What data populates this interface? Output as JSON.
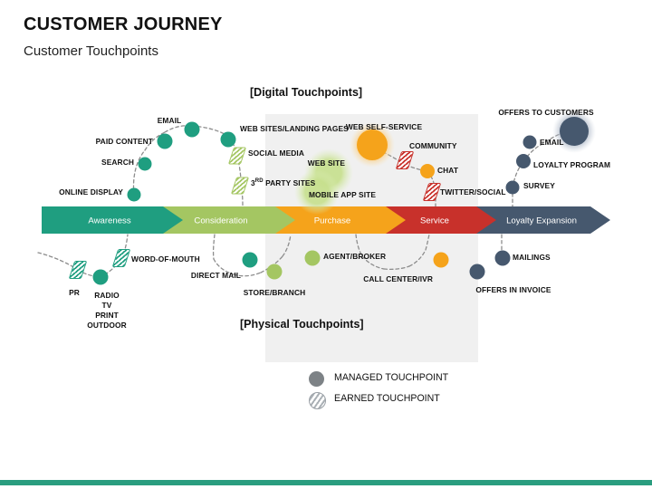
{
  "header": {
    "title": "CUSTOMER JOURNEY",
    "subtitle": "Customer Touchpoints"
  },
  "sections": {
    "digital": "[Digital Touchpoints]",
    "physical": "[Physical Touchpoints]"
  },
  "stages": [
    {
      "label": "Awareness",
      "color": "#1f9e80"
    },
    {
      "label": "Consideration",
      "color": "#a4c662"
    },
    {
      "label": "Purchase",
      "color": "#f5a31b"
    },
    {
      "label": "Service",
      "color": "#c8312b"
    },
    {
      "label": "Loyalty Expansion",
      "color": "#46586e"
    }
  ],
  "legend": [
    {
      "label": "MANAGED TOUCHPOINT",
      "kind": "managed"
    },
    {
      "label": "EARNED TOUCHPOINT",
      "kind": "earned"
    }
  ],
  "digital_touchpoints": [
    {
      "label": "ONLINE DISPLAY",
      "kind": "managed",
      "color": "#1f9e80"
    },
    {
      "label": "SEARCH",
      "kind": "managed",
      "color": "#1f9e80"
    },
    {
      "label": "PAID CONTENT",
      "kind": "managed",
      "color": "#1f9e80"
    },
    {
      "label": "EMAIL",
      "kind": "managed",
      "color": "#1f9e80"
    },
    {
      "label": "WEB SITES/LANDING PAGES",
      "kind": "managed",
      "color": "#1f9e80"
    },
    {
      "label": "SOCIAL MEDIA",
      "kind": "earned",
      "color": "#a4c662"
    },
    {
      "label": "3RD PARTY SITES",
      "kind": "earned",
      "color": "#a4c662"
    },
    {
      "label": "WEB SITE",
      "kind": "managed",
      "color": "#b9d77e"
    },
    {
      "label": "MOBILE APP SITE",
      "kind": "managed",
      "color": "#b9d77e"
    },
    {
      "label": "WEB SELF-SERVICE",
      "kind": "managed",
      "color": "#f5a31b"
    },
    {
      "label": "COMMUNITY",
      "kind": "earned",
      "color": "#c8312b"
    },
    {
      "label": "CHAT",
      "kind": "managed",
      "color": "#f5a31b"
    },
    {
      "label": "TWITTER/SOCIAL",
      "kind": "earned",
      "color": "#c8312b"
    },
    {
      "label": "SURVEY",
      "kind": "managed",
      "color": "#46586e"
    },
    {
      "label": "LOYALTY PROGRAM",
      "kind": "managed",
      "color": "#46586e"
    },
    {
      "label": "EMAIL",
      "kind": "managed",
      "color": "#46586e"
    },
    {
      "label": "OFFERS TO CUSTOMERS",
      "kind": "managed",
      "color": "#46586e"
    }
  ],
  "physical_touchpoints": [
    {
      "label": "PR",
      "kind": "earned",
      "color": "#1f9e80"
    },
    {
      "label": "RADIO\nTV\nPRINT\nOUTDOOR",
      "kind": "managed",
      "color": "#1f9e80"
    },
    {
      "label": "WORD-OF-MOUTH",
      "kind": "earned",
      "color": "#1f9e80"
    },
    {
      "label": "DIRECT MAIL",
      "kind": "managed",
      "color": "#1f9e80"
    },
    {
      "label": "STORE/BRANCH",
      "kind": "managed",
      "color": "#a4c662"
    },
    {
      "label": "AGENT/BROKER",
      "kind": "managed",
      "color": "#a4c662"
    },
    {
      "label": "CALL CENTER/IVR",
      "kind": "managed",
      "color": "#f5a31b"
    },
    {
      "label": "OFFERS IN INVOICE",
      "kind": "managed",
      "color": "#46586e"
    },
    {
      "label": "MAILINGS",
      "kind": "managed",
      "color": "#46586e"
    }
  ],
  "node_labels": {
    "online_display": "ONLINE DISPLAY",
    "search": "SEARCH",
    "paid_content": "PAID CONTENT",
    "email_awareness": "EMAIL",
    "web_sites_landing": "WEB SITES/LANDING PAGES",
    "social_media": "SOCIAL MEDIA",
    "third_party_prefix": "3",
    "third_party_sup": "RD",
    "third_party_rest": " PARTY SITES",
    "web_site": "WEB SITE",
    "mobile_app_site": "MOBILE APP SITE",
    "web_self_service": "WEB SELF-SERVICE",
    "community": "COMMUNITY",
    "chat": "CHAT",
    "twitter_social": "TWITTER/SOCIAL",
    "offers_to_customers": "OFFERS TO CUSTOMERS",
    "email_loyalty": "EMAIL",
    "loyalty_program": "LOYALTY PROGRAM",
    "survey": "SURVEY",
    "pr": "PR",
    "radio": "RADIO",
    "tv": "TV",
    "print": "PRINT",
    "outdoor": "OUTDOOR",
    "word_of_mouth": "WORD-OF-MOUTH",
    "direct_mail": "DIRECT MAIL",
    "store_branch": "STORE/BRANCH",
    "agent_broker": "AGENT/BROKER",
    "call_center": "CALL CENTER/IVR",
    "offers_in_invoice": "OFFERS IN INVOICE",
    "mailings": "MAILINGS"
  },
  "colors": {
    "teal": "#1f9e80",
    "green": "#a4c662",
    "green_light": "#b9d77e",
    "orange": "#f5a31b",
    "red": "#c8312b",
    "slate": "#46586e",
    "panel": "#f0f0f0",
    "legend_gray": "#7d8286",
    "bottom_bar": "#2a9d7f"
  }
}
